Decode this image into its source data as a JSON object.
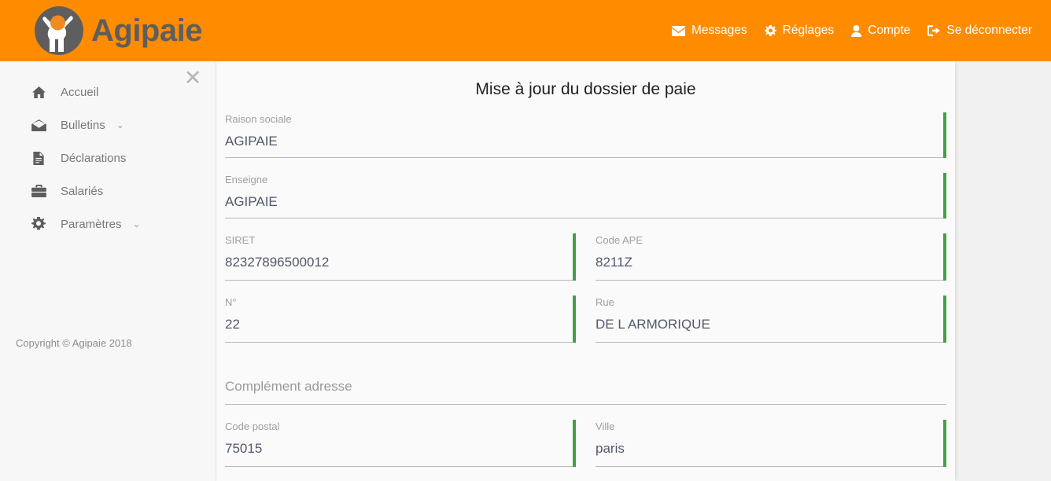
{
  "header": {
    "brand": {
      "name": "Agipaie",
      "logo_icon": "agipaie-logo",
      "circle_color": "#5e5e5e",
      "accent_color": "#f18a21"
    },
    "background_color": "#ff8c00",
    "nav": [
      {
        "label": "Messages",
        "icon": "envelope-icon"
      },
      {
        "label": "Réglages",
        "icon": "gear-icon"
      },
      {
        "label": "Compte",
        "icon": "user-icon"
      },
      {
        "label": "Se déconnecter",
        "icon": "sign-out-icon"
      }
    ]
  },
  "sidebar": {
    "close_label": "✕",
    "items": [
      {
        "label": "Accueil",
        "icon": "home-icon",
        "caret": ""
      },
      {
        "label": "Bulletins",
        "icon": "envelope-open-icon",
        "caret": "⌄"
      },
      {
        "label": "Déclarations",
        "icon": "file-icon",
        "caret": ""
      },
      {
        "label": "Salariés",
        "icon": "briefcase-icon",
        "caret": ""
      },
      {
        "label": "Paramètres",
        "icon": "gear-icon",
        "caret": "⌄"
      }
    ],
    "copyright": "Copyright © Agipaie 2018"
  },
  "main": {
    "title": "Mise à jour du dossier de paie",
    "valid_bar_color": "#43a047",
    "fields": {
      "raison_sociale": {
        "label": "Raison sociale",
        "value": "AGIPAIE",
        "placeholder": ""
      },
      "enseigne": {
        "label": "Enseigne",
        "value": "AGIPAIE",
        "placeholder": ""
      },
      "siret": {
        "label": "SIRET",
        "value": "82327896500012",
        "placeholder": ""
      },
      "code_ape": {
        "label": "Code APE",
        "value": "8211Z",
        "placeholder": ""
      },
      "numero": {
        "label": "N°",
        "value": "22",
        "placeholder": ""
      },
      "rue": {
        "label": "Rue",
        "value": "DE L ARMORIQUE",
        "placeholder": ""
      },
      "complement_adresse": {
        "label": "",
        "value": "",
        "placeholder": "Complément adresse"
      },
      "code_postal": {
        "label": "Code postal",
        "value": "75015",
        "placeholder": ""
      },
      "ville": {
        "label": "Ville",
        "value": "paris",
        "placeholder": ""
      }
    }
  }
}
